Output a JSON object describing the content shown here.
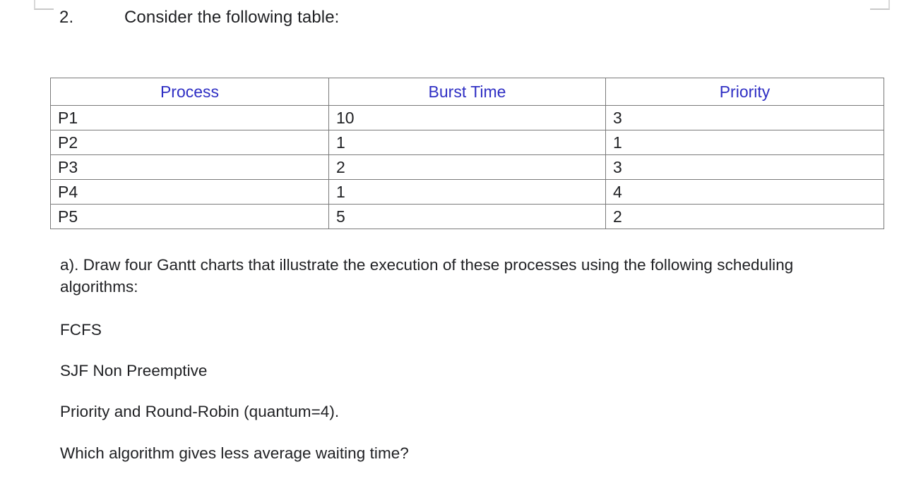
{
  "page": {
    "background": "#ffffff",
    "header_color": "#2f2fc4",
    "text_color": "#202124"
  },
  "question": {
    "number": "2.",
    "prompt": "Consider the following table:"
  },
  "table": {
    "columns": [
      "Process",
      "Burst Time",
      "Priority"
    ],
    "rows": [
      [
        "P1",
        "10",
        "3"
      ],
      [
        "P2",
        "1",
        "1"
      ],
      [
        "P3",
        "2",
        "3"
      ],
      [
        "P4",
        "1",
        "4"
      ],
      [
        "P5",
        "5",
        "2"
      ]
    ]
  },
  "parts": {
    "a_instruction": "a). Draw four Gantt charts that illustrate the execution of these processes using the following scheduling algorithms:",
    "algorithms": [
      "FCFS",
      "SJF Non Preemptive",
      "Priority and Round-Robin (quantum=4)."
    ],
    "final_question": "Which algorithm gives less average waiting time?"
  }
}
